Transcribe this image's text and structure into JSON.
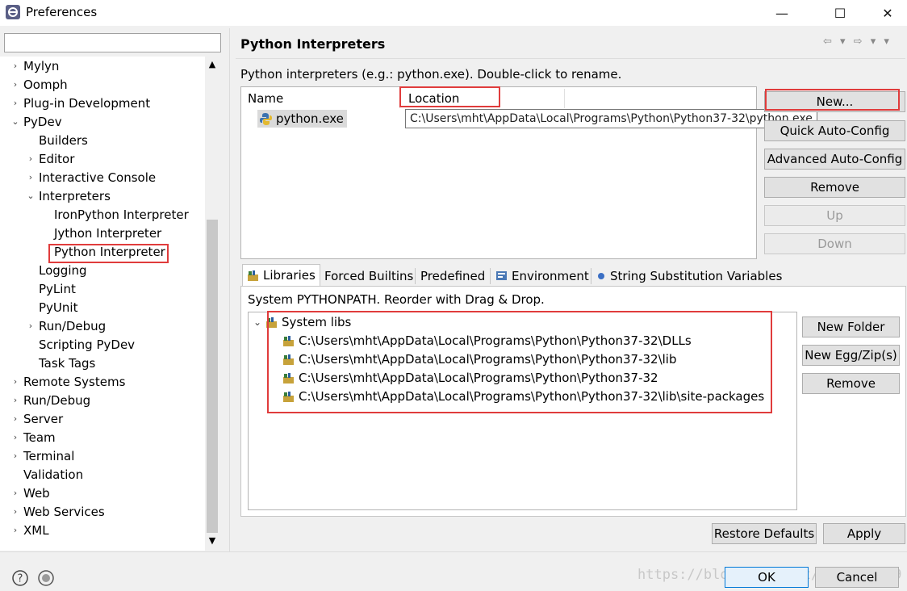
{
  "window": {
    "title": "Preferences",
    "minimize_glyph": "—",
    "maximize_glyph": "☐",
    "close_glyph": "✕"
  },
  "filter": {
    "value": "",
    "placeholder": ""
  },
  "tree": {
    "items": [
      {
        "label": "Mylyn",
        "chevron": "›"
      },
      {
        "label": "Oomph",
        "chevron": "›"
      },
      {
        "label": "Plug-in Development",
        "chevron": "›"
      },
      {
        "label": "PyDev",
        "chevron": "⌄"
      },
      {
        "label": "Builders",
        "chevron": ""
      },
      {
        "label": "Editor",
        "chevron": "›"
      },
      {
        "label": "Interactive Console",
        "chevron": "›"
      },
      {
        "label": "Interpreters",
        "chevron": "⌄"
      },
      {
        "label": "IronPython Interpreter",
        "chevron": ""
      },
      {
        "label": "Jython Interpreter",
        "chevron": ""
      },
      {
        "label": "Python Interpreter",
        "chevron": ""
      },
      {
        "label": "Logging",
        "chevron": ""
      },
      {
        "label": "PyLint",
        "chevron": ""
      },
      {
        "label": "PyUnit",
        "chevron": ""
      },
      {
        "label": "Run/Debug",
        "chevron": "›"
      },
      {
        "label": "Scripting PyDev",
        "chevron": ""
      },
      {
        "label": "Task Tags",
        "chevron": ""
      },
      {
        "label": "Remote Systems",
        "chevron": "›"
      },
      {
        "label": "Run/Debug",
        "chevron": "›"
      },
      {
        "label": "Server",
        "chevron": "›"
      },
      {
        "label": "Team",
        "chevron": "›"
      },
      {
        "label": "Terminal",
        "chevron": "›"
      },
      {
        "label": "Validation",
        "chevron": ""
      },
      {
        "label": "Web",
        "chevron": "›"
      },
      {
        "label": "Web Services",
        "chevron": "›"
      },
      {
        "label": "XML",
        "chevron": "›"
      }
    ],
    "selected": "Python Interpreter"
  },
  "page": {
    "title": "Python Interpreters",
    "nav_arrows": "⇦ ▾ ⇨ ▾ ▾",
    "description": "Python interpreters (e.g.: python.exe).   Double-click to rename.",
    "table": {
      "col_name": "Name",
      "col_location": "Location",
      "row_name": "python.exe",
      "tooltip": "C:\\Users\\mht\\AppData\\Local\\Programs\\Python\\Python37-32\\python.exe"
    },
    "buttons": {
      "new": "New...",
      "quick_auto": "Quick Auto-Config",
      "advanced_auto": "Advanced Auto-Config",
      "remove": "Remove",
      "up": "Up",
      "down": "Down"
    }
  },
  "tabs": [
    {
      "label": "Libraries"
    },
    {
      "label": "Forced Builtins"
    },
    {
      "label": "Predefined"
    },
    {
      "label": "Environment"
    },
    {
      "label": "String Substitution Variables"
    }
  ],
  "libraries": {
    "description": "System PYTHONPATH.   Reorder with Drag & Drop.",
    "root": "System libs",
    "root_chevron": "⌄",
    "paths": [
      "C:\\Users\\mht\\AppData\\Local\\Programs\\Python\\Python37-32\\DLLs",
      "C:\\Users\\mht\\AppData\\Local\\Programs\\Python\\Python37-32\\lib",
      "C:\\Users\\mht\\AppData\\Local\\Programs\\Python\\Python37-32",
      "C:\\Users\\mht\\AppData\\Local\\Programs\\Python\\Python37-32\\lib\\site-packages"
    ],
    "buttons": {
      "new_folder": "New Folder",
      "new_egg": "New Egg/Zip(s)",
      "remove": "Remove"
    }
  },
  "footer": {
    "restore_defaults": "Restore Defaults",
    "apply": "Apply",
    "ok": "OK",
    "cancel": "Cancel",
    "watermark": "https://blog.csdn.net/u011745069"
  },
  "colors": {
    "highlight_red": "#e03c3c",
    "selection_gray": "#dadada",
    "default_button_border": "#0078d7"
  }
}
